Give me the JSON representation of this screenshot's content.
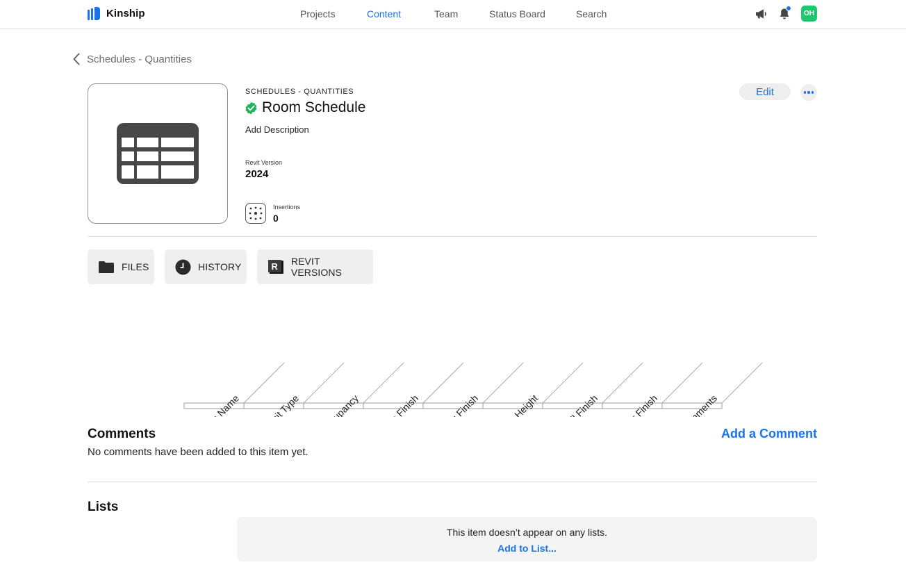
{
  "app": {
    "name": "Kinship"
  },
  "nav": {
    "items": [
      {
        "label": "Projects",
        "active": false
      },
      {
        "label": "Content",
        "active": true
      },
      {
        "label": "Team",
        "active": false
      },
      {
        "label": "Status Board",
        "active": false
      },
      {
        "label": "Search",
        "active": false
      }
    ]
  },
  "header_icons": {
    "announcements_icon": "megaphone-icon",
    "notifications_icon": "bell-icon",
    "notifications_unread": true,
    "avatar_initials": "OH",
    "avatar_color": "#1fc86e"
  },
  "breadcrumb": {
    "label": "Schedules - Quantities"
  },
  "item": {
    "category": "SCHEDULES - QUANTITIES",
    "title": "Room Schedule",
    "verified": true,
    "description_placeholder": "Add Description",
    "revit_version_label": "Revit Version",
    "revit_version": "2024",
    "insertions_label": "Insertions",
    "insertions": "0",
    "thumbnail_icon": "table-icon"
  },
  "actions": {
    "edit_label": "Edit",
    "more_icon": "more-horizontal-icon"
  },
  "tabs": [
    {
      "label": "FILES",
      "icon": "folder-icon"
    },
    {
      "label": "HISTORY",
      "icon": "clock-icon"
    },
    {
      "label": "REVIT VERSIONS",
      "icon": "revit-icon"
    }
  ],
  "schedule_columns": [
    "Room Name",
    "Unit Type",
    "Occupancy",
    "Base Finish",
    "Ceiling Finish",
    "Ceiling Height",
    "Wall Finish",
    "Floor Finish",
    "Comments"
  ],
  "comments": {
    "title": "Comments",
    "add_label": "Add a Comment",
    "empty_text": "No comments have been added to this item yet."
  },
  "lists": {
    "title": "Lists",
    "empty_text": "This item doesn’t appear on any lists.",
    "add_label": "Add to List..."
  },
  "colors": {
    "accent": "#1a73e8",
    "verified": "#1fb35a",
    "tab_bg": "#efefef"
  }
}
